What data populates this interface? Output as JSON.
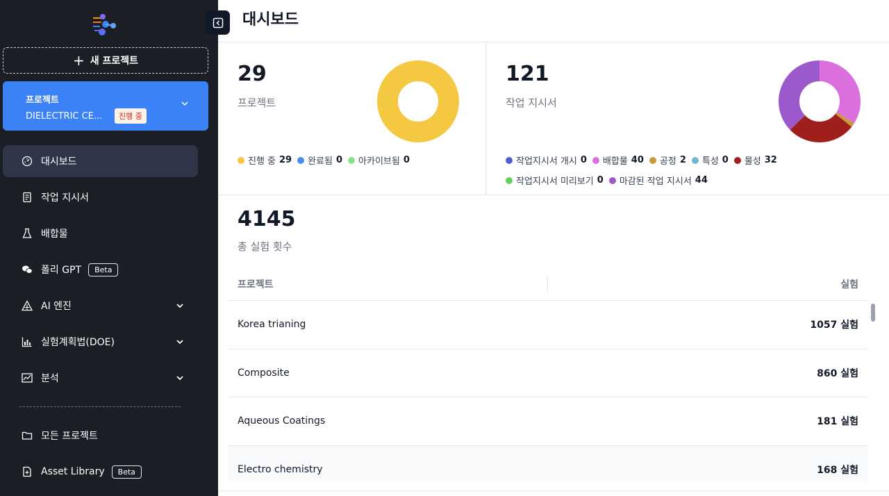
{
  "sidebar": {
    "new_project_label": "새 프로젝트",
    "project_card": {
      "title": "프로젝트",
      "name": "DIELECTRIC CE...",
      "badge": "진행 중"
    },
    "nav": [
      {
        "label": "대시보드",
        "icon": "dashboard-icon",
        "active": true
      },
      {
        "label": "작업 지시서",
        "icon": "document-icon"
      },
      {
        "label": "배합물",
        "icon": "flask-icon"
      },
      {
        "label": "폴리 GPT",
        "icon": "chat-icon",
        "badge": "Beta"
      },
      {
        "label": "AI 엔진",
        "icon": "triangle-icon",
        "expandable": true
      },
      {
        "label": "실험계획법(DOE)",
        "icon": "bar-chart-icon",
        "expandable": true
      },
      {
        "label": "분석",
        "icon": "line-chart-icon",
        "expandable": true
      },
      {
        "label": "모든 프로젝트",
        "icon": "folder-icon"
      },
      {
        "label": "Asset Library",
        "icon": "file-icon",
        "badge": "Beta"
      }
    ]
  },
  "header": {
    "title": "대시보드"
  },
  "stats": {
    "projects": {
      "count": "29",
      "label": "프로젝트",
      "legend": [
        {
          "label": "진행 중",
          "value": 29,
          "color": "#f5c842"
        },
        {
          "label": "완료됨",
          "value": 0,
          "color": "#4a8ee8"
        },
        {
          "label": "아카이브됨",
          "value": 0,
          "color": "#86e28e"
        }
      ]
    },
    "work_orders": {
      "count": "121",
      "label": "작업 지시서",
      "legend": [
        {
          "label": "작업지시서 개시",
          "value": 0,
          "color": "#4f5fd6"
        },
        {
          "label": "배합물",
          "value": 40,
          "color": "#db6fdd"
        },
        {
          "label": "공정",
          "value": 2,
          "color": "#c99a3c"
        },
        {
          "label": "특성",
          "value": 0,
          "color": "#74b6cf"
        },
        {
          "label": "물성",
          "value": 32,
          "color": "#9e1f1c"
        },
        {
          "label": "작업지시서 미리보기",
          "value": 0,
          "color": "#5fd35a"
        },
        {
          "label": "마감된 작업 지시서",
          "value": 44,
          "color": "#9b59cc"
        }
      ]
    },
    "experiments": {
      "count": "4145",
      "label": "총 실험 횟수"
    }
  },
  "table": {
    "col_project": "프로젝트",
    "col_experiments": "실험",
    "rows": [
      {
        "name": "Korea trianing",
        "value": "1057 실험"
      },
      {
        "name": "Composite",
        "value": "860 실험"
      },
      {
        "name": "Aqueous Coatings",
        "value": "181 실험"
      },
      {
        "name": "Electro chemistry",
        "value": "168 실험"
      }
    ]
  }
}
